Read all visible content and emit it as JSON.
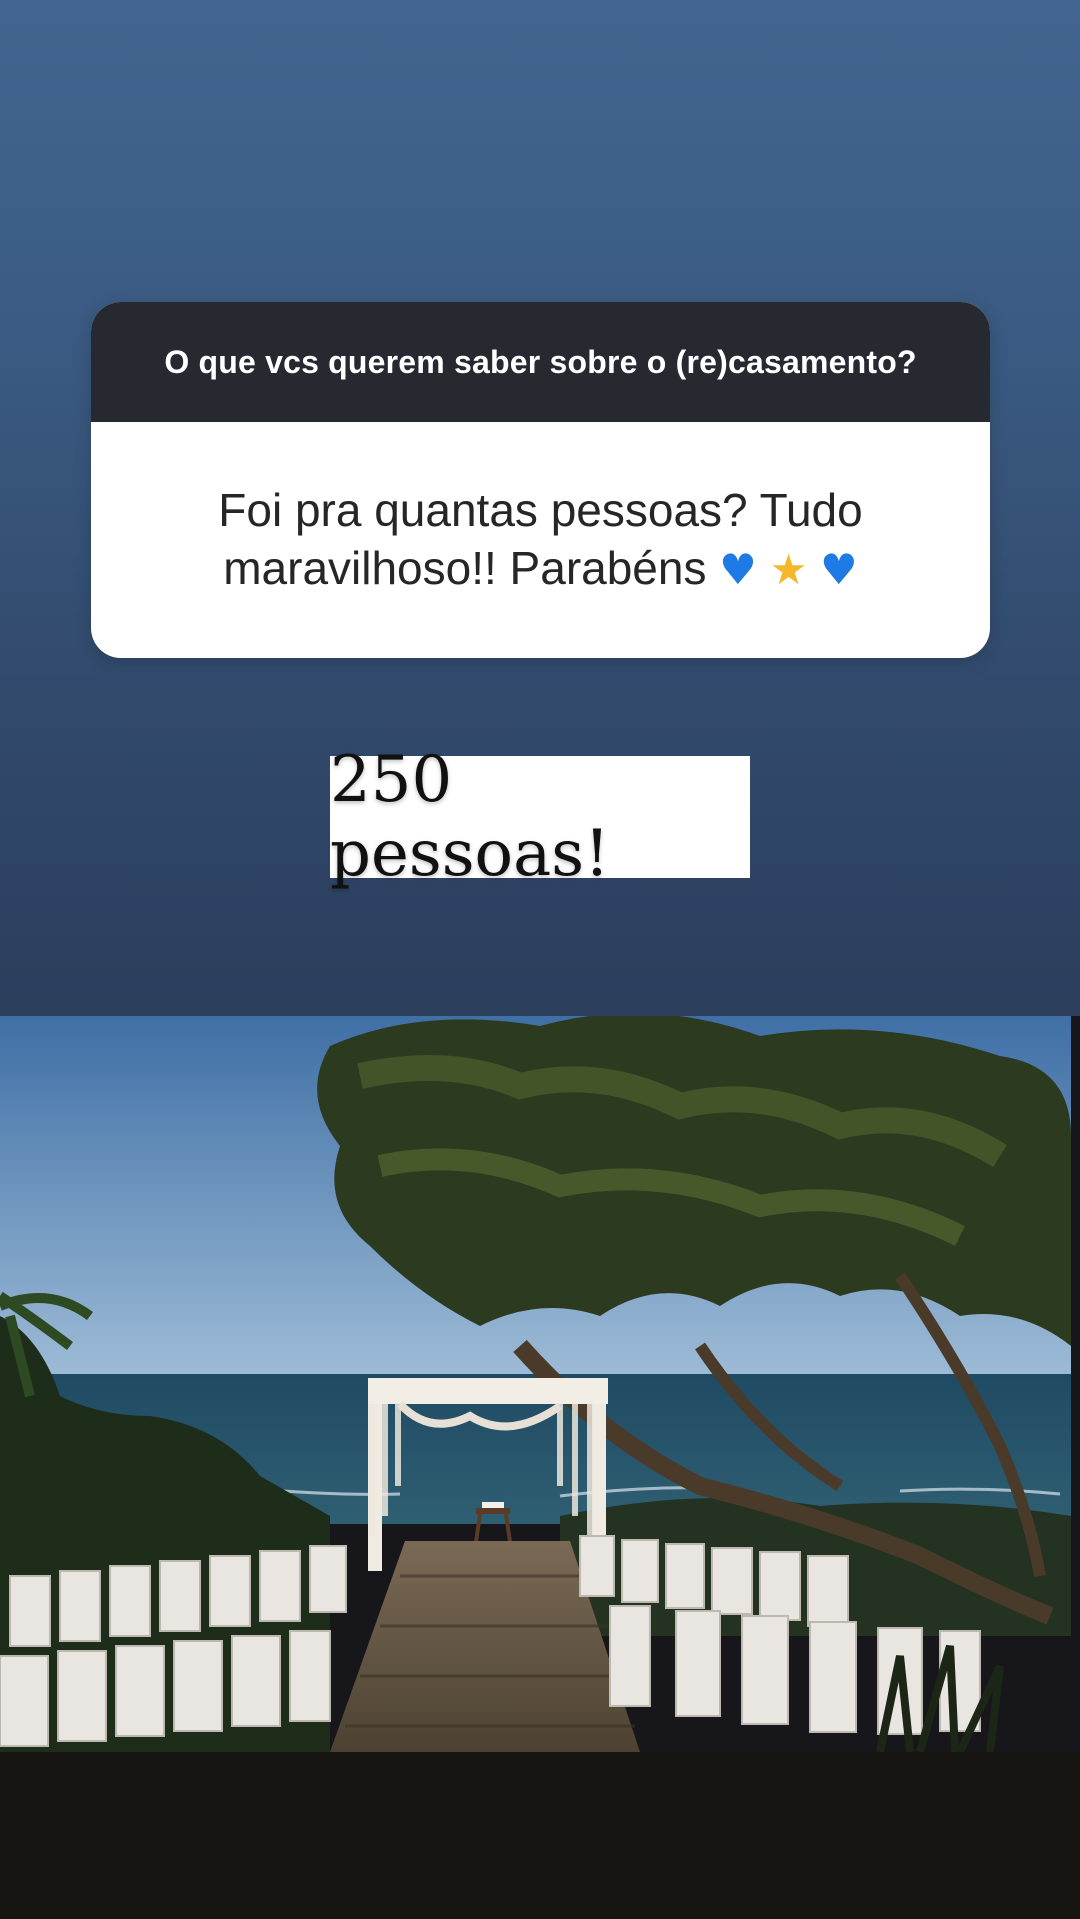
{
  "story": {
    "question": {
      "header": "O que vcs querem saber sobre o (re)casamento?",
      "response_text": "Foi pra quantas pessoas? Tudo maravilhoso!! Parabéns",
      "emojis": [
        {
          "name": "blue-heart-icon",
          "glyph": "♥"
        },
        {
          "name": "glowing-star-icon",
          "glyph": "★"
        },
        {
          "name": "blue-heart-icon",
          "glyph": "♥"
        }
      ]
    },
    "answer": "250 pessoas!",
    "photo": {
      "subject": "wedding-ceremony-seaside"
    },
    "colors": {
      "bg_top": "#42658f",
      "bg_bottom": "#2b3e5c",
      "card_header": "#262a30",
      "heart": "#1e7be6",
      "star": "#f5b82a"
    }
  }
}
